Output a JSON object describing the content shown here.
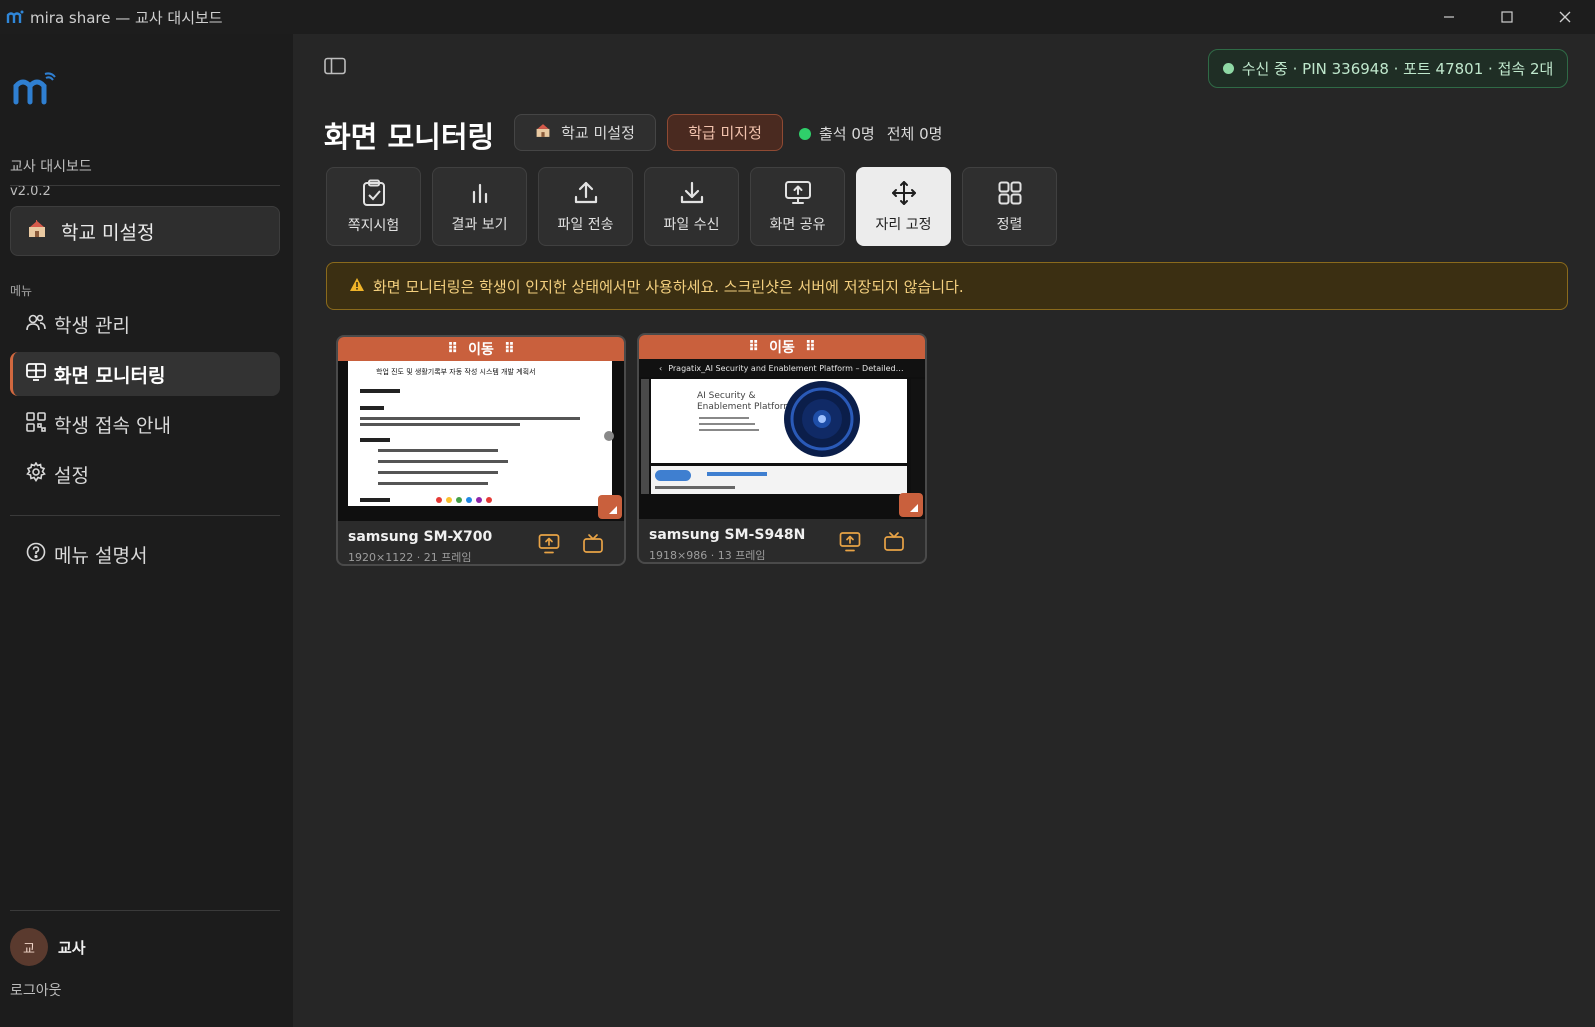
{
  "window": {
    "title": "mira share — 교사 대시보드"
  },
  "sidebar": {
    "app_name": "교사 대시보드",
    "version": "v2.0.2",
    "school": "학교 미설정",
    "menu_label": "메뉴",
    "items": [
      {
        "label": "학생 관리",
        "icon": "users-icon"
      },
      {
        "label": "화면 모니터링",
        "icon": "monitor-grid-icon",
        "active": true
      },
      {
        "label": "학생 접속 안내",
        "icon": "qr-icon"
      },
      {
        "label": "설정",
        "icon": "gear-icon"
      }
    ],
    "help": "메뉴 설명서",
    "user": {
      "avatar": "교",
      "name": "교사"
    },
    "logout": "로그아웃"
  },
  "status": {
    "text": "수신 중 · PIN 336948 · 포트 47801 · 접속 2대",
    "color": "#8fd8a5"
  },
  "header": {
    "title": "화면 모니터링",
    "school_chip": "학교 미설정",
    "class_chip": "학급 미지정",
    "attendance": "출석 0명",
    "total": "전체 0명"
  },
  "toolbar": [
    {
      "label": "쪽지시험",
      "icon": "clipboard-check-icon"
    },
    {
      "label": "결과 보기",
      "icon": "bar-chart-icon"
    },
    {
      "label": "파일 전송",
      "icon": "upload-icon"
    },
    {
      "label": "파일 수신",
      "icon": "download-icon"
    },
    {
      "label": "화면 공유",
      "icon": "screen-share-icon"
    },
    {
      "label": "자리 고정",
      "icon": "move-icon",
      "active": true
    },
    {
      "label": "정렬",
      "icon": "grid-icon"
    }
  ],
  "warning": {
    "text": "화면 모니터링은 학생이 인지한 상태에서만 사용하세요. 스크린샷은 서버에 저장되지 않습니다."
  },
  "devices": [
    {
      "move_label": "이동",
      "name": "samsung SM-X700",
      "meta": "1920×1122 · 21 프레임",
      "doc_title": "학업 진도 및 생활기록부 자동 작성 시스템 개발 계획서"
    },
    {
      "move_label": "이동",
      "name": "samsung SM-S948N",
      "meta": "1918×986 · 13 프레임",
      "slide_title": "Pragatix_AI Security and Enablement Platform – Detailed…"
    }
  ],
  "colors": {
    "accent": "#c9603d",
    "active_nav_border": "#d1683f",
    "warning_text": "#f3cf7e",
    "status_border": "#2f6a46"
  }
}
